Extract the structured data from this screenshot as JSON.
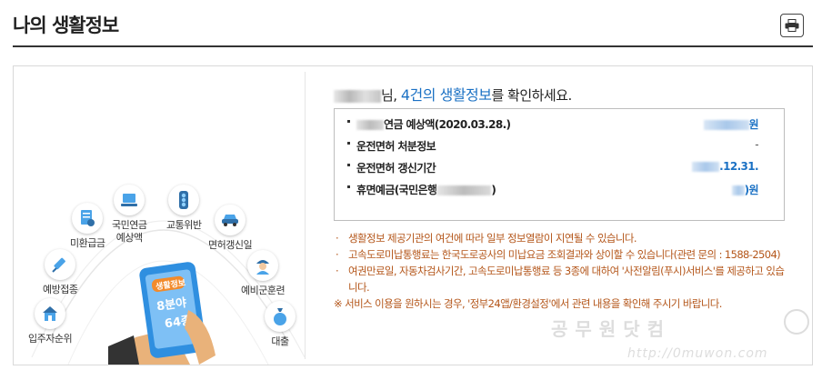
{
  "header": {
    "title": "나의 생활정보",
    "print_icon": "printer-icon"
  },
  "illustration": {
    "phone_badge": "생활정보",
    "phone_line1": "8분야",
    "phone_line2": "64종",
    "items": [
      {
        "label": "국민연금\n예상액",
        "icon": "laptop-icon"
      },
      {
        "label": "교통위반",
        "icon": "traffic-light-icon"
      },
      {
        "label": "미환급금",
        "icon": "receipt-icon"
      },
      {
        "label": "면허갱신일",
        "icon": "car-icon"
      },
      {
        "label": "예방접종",
        "icon": "syringe-icon"
      },
      {
        "label": "예비군훈련",
        "icon": "soldier-icon"
      },
      {
        "label": "입주자순위",
        "icon": "house-icon"
      },
      {
        "label": "대출",
        "icon": "money-bag-icon"
      }
    ]
  },
  "greeting": {
    "suffix": "님,",
    "highlight": "4건의 생활정보",
    "tail": "를 확인하세요."
  },
  "info_rows": [
    {
      "label": "연금 예상액(2020.03.28.)",
      "value": "원",
      "has_label_blur": true,
      "value_blur": "blue"
    },
    {
      "label": "운전면허 처분정보",
      "value": "-",
      "has_label_blur": false,
      "value_blur": "none"
    },
    {
      "label": "운전면허 갱신기간",
      "value": ".12.31.",
      "has_label_blur": false,
      "value_blur": "blue"
    },
    {
      "label": "휴면예금(국민은행",
      "label_tail": ")",
      "value": ")원",
      "has_label_blur": false,
      "value_blur": "blue"
    }
  ],
  "notes": [
    "생활정보 제공기관의 여건에 따라 일부 정보열람이 지연될 수 있습니다.",
    "고속도로미납통행료는 한국도로공사의 미납요금 조회결과와 상이할 수 있습니다(관련 문의 : 1588-2504)",
    "여권만료일, 자동차검사기간, 고속도로미납통행료 등 3종에 대하여 '사전알림(푸시)서비스'를 제공하고 있습니다."
  ],
  "special_note": "※ 서비스 이용을 원하시는 경우, '정부24앱/환경설정'에서 관련 내용을 확인해 주시기 바랍니다.",
  "note_mark": "·",
  "watermark": {
    "text": "공무원닷컴",
    "url": "http://0muwon.com"
  },
  "colors": {
    "accent": "#1b71c4",
    "note": "#b4561a",
    "phone": "#2f8fe0"
  }
}
